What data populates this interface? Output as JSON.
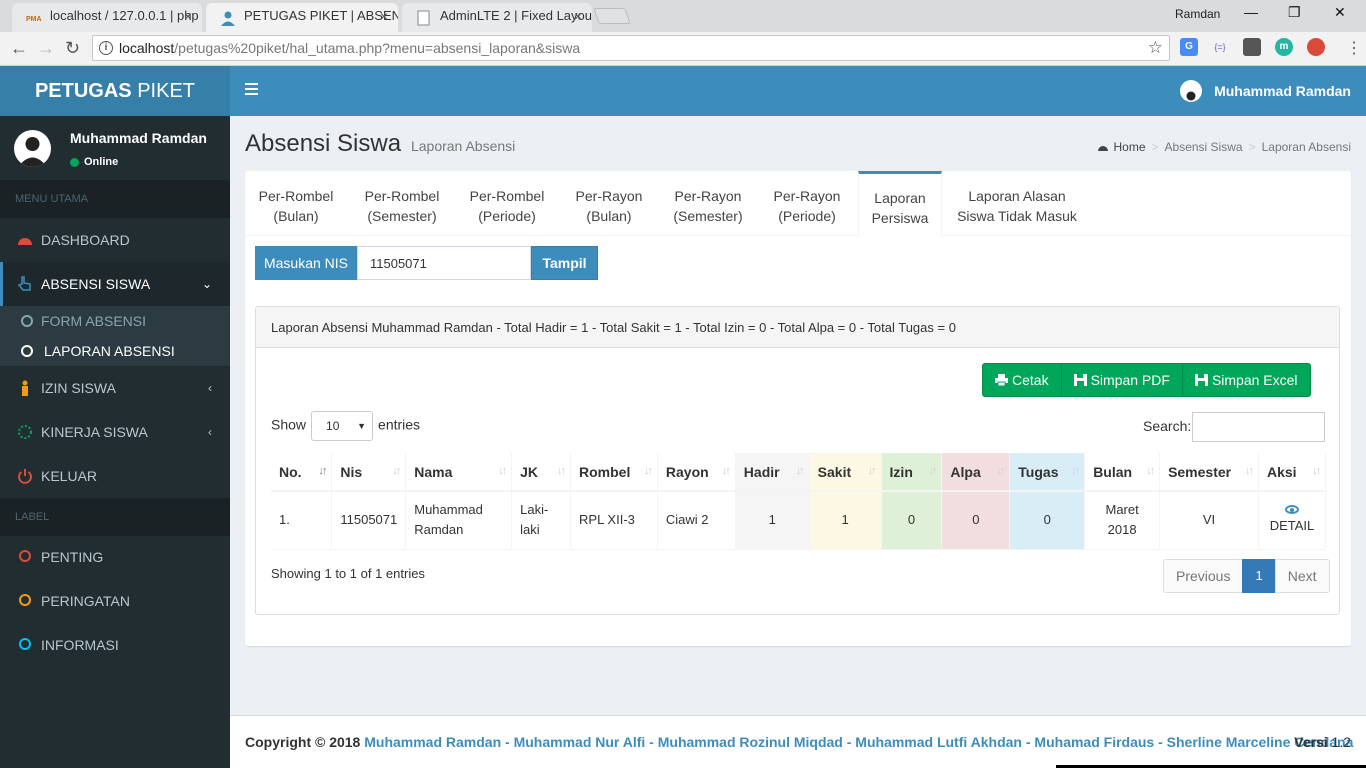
{
  "browser": {
    "tabs": [
      {
        "title": "localhost / 127.0.0.1 | php",
        "active": false
      },
      {
        "title": "PETUGAS PIKET | ABSENS",
        "active": true
      },
      {
        "title": "AdminLTE 2 | Fixed Layou",
        "active": false
      }
    ],
    "tab_close": "×",
    "fav_pma": "PMA",
    "window_user": "Ramdan",
    "win_min": "—",
    "win_restore": "❐",
    "win_close": "✕",
    "back": "←",
    "forward": "→",
    "reload": "↻",
    "info": "i",
    "star": "☆",
    "url_host": "localhost",
    "url_path": "/petugas%20piket/hal_utama.php?menu=absensi_laporan&siswa",
    "ext_m": "m",
    "ext_code": "{=}",
    "menu": "⋮"
  },
  "app": {
    "logo_bold": "PETUGAS",
    "logo_light": " PIKET",
    "top_user": "Muhammad Ramdan",
    "brand_color": "#3c8dbc"
  },
  "sidebar": {
    "user_name": "Muhammad Ramdan",
    "user_status": "Online",
    "header_main": "MENU UTAMA",
    "header_label": "LABEL",
    "items": {
      "dashboard": "DASHBOARD",
      "absensi": "ABSENSI SISWA",
      "form_absensi": "FORM ABSENSI",
      "laporan_absensi": "LAPORAN ABSENSI",
      "izin": "IZIN SISWA",
      "kinerja": "KINERJA SISWA",
      "keluar": "KELUAR",
      "penting": "PENTING",
      "peringatan": "PERINGATAN",
      "informasi": "INFORMASI"
    },
    "caret_down": "⌄",
    "caret_left": "‹"
  },
  "content": {
    "title": "Absensi Siswa",
    "subtitle": "Laporan Absensi",
    "breadcrumb": {
      "home": "Home",
      "b1": "Absensi Siswa",
      "b2": "Laporan Absensi",
      "sep": ">"
    },
    "tabs": [
      {
        "l1": "Per-Rombel",
        "l2": "(Bulan)"
      },
      {
        "l1": "Per-Rombel",
        "l2": "(Semester)"
      },
      {
        "l1": "Per-Rombel",
        "l2": "(Periode)"
      },
      {
        "l1": "Per-Rayon",
        "l2": "(Bulan)"
      },
      {
        "l1": "Per-Rayon",
        "l2": "(Semester)"
      },
      {
        "l1": "Per-Rayon",
        "l2": "(Periode)"
      },
      {
        "l1": "Laporan",
        "l2": "Persiswa"
      },
      {
        "l1": "Laporan Alasan",
        "l2": "Siswa Tidak Masuk"
      }
    ],
    "nis_label": "Masukan NIS",
    "nis_value": "11505071",
    "tampil": "Tampil",
    "report_header": "Laporan Absensi Muhammad Ramdan  - Total Hadir = 1 - Total Sakit = 1 - Total Izin = 0 - Total Alpa = 0 - Total Tugas = 0",
    "buttons": {
      "cetak": "Cetak",
      "pdf": "Simpan PDF",
      "excel": "Simpan Excel"
    },
    "show": "Show",
    "entries_value": "10",
    "entries": "entries",
    "search_label": "Search:",
    "search_value": "",
    "columns": [
      "No.",
      "Nis",
      "Nama",
      "JK",
      "Rombel",
      "Rayon",
      "Hadir",
      "Sakit",
      "Izin",
      "Alpa",
      "Tugas",
      "Bulan",
      "Semester",
      "Aksi"
    ],
    "sort_icon": "↓↑",
    "row": {
      "no": "1.",
      "nis": "11505071",
      "nama_1": "Muhammad",
      "nama_2": "Ramdan",
      "jk_1": "Laki-",
      "jk_2": "laki",
      "rombel": "RPL XII-3",
      "rayon": "Ciawi 2",
      "hadir": "1",
      "sakit": "1",
      "izin": "0",
      "alpa": "0",
      "tugas": "0",
      "bulan_1": "Maret",
      "bulan_2": "2018",
      "semester": "VI",
      "aksi": "DETAIL"
    },
    "showing": "Showing 1 to 1 of 1 entries",
    "pager": {
      "prev": "Previous",
      "page": "1",
      "next": "Next"
    }
  },
  "footer": {
    "copy": "Copyright © 2018",
    "names": "Muhammad Ramdan - Muhammad Nur Alfi - Muhammad Rozinul Miqdad - Muhammad Lutfi Akhdan - Muhamad Firdaus - Sherline Marceline Cendana",
    "versi_label": "Versi",
    "versi": "1.2"
  }
}
